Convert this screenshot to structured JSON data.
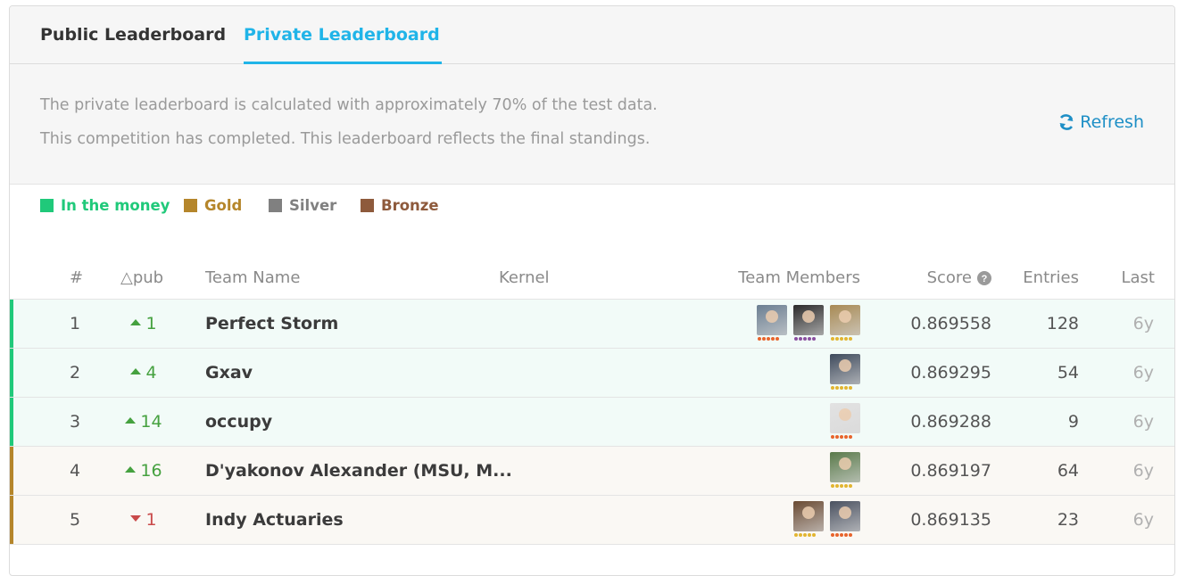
{
  "tabs": [
    {
      "label": "Public Leaderboard",
      "active": false
    },
    {
      "label": "Private Leaderboard",
      "active": true
    }
  ],
  "info": {
    "line1": "The private leaderboard is calculated with approximately 70% of the test data.",
    "line2": "This competition has completed. This leaderboard reflects the final standings.",
    "refresh_label": "Refresh",
    "refresh_icon": "refresh-icon"
  },
  "legend": [
    {
      "label": "In the money",
      "color": "#20c97a"
    },
    {
      "label": "Gold",
      "color": "#b5862b"
    },
    {
      "label": "Silver",
      "color": "#808080"
    },
    {
      "label": "Bronze",
      "color": "#8e5a3c"
    }
  ],
  "columns": {
    "rank": "#",
    "delta": "△pub",
    "team": "Team Name",
    "kernel": "Kernel",
    "members": "Team Members",
    "score": "Score",
    "entries": "Entries",
    "last": "Last"
  },
  "rows": [
    {
      "rank": "1",
      "delta": "1",
      "dir": "up",
      "team": "Perfect Storm",
      "score": "0.869558",
      "entries": "128",
      "last": "6y",
      "tier": "money",
      "members": [
        {
          "bg": "#6b7f92",
          "dots": "#e8642c"
        },
        {
          "bg": "#2a2a2a",
          "dots": "#8a4fa0"
        },
        {
          "bg": "#a88a54",
          "dots": "#e2b530"
        }
      ]
    },
    {
      "rank": "2",
      "delta": "4",
      "dir": "up",
      "team": "Gxav",
      "score": "0.869295",
      "entries": "54",
      "last": "6y",
      "tier": "money",
      "members": [
        {
          "bg": "#3e4a5c",
          "dots": "#e2b530"
        }
      ]
    },
    {
      "rank": "3",
      "delta": "14",
      "dir": "up",
      "team": "occupy",
      "score": "0.869288",
      "entries": "9",
      "last": "6y",
      "tier": "money",
      "members": [
        {
          "bg": "#e2e2e2",
          "dots": "#e8642c"
        }
      ]
    },
    {
      "rank": "4",
      "delta": "16",
      "dir": "up",
      "team": "D'yakonov Alexander (MSU, M...",
      "score": "0.869197",
      "entries": "64",
      "last": "6y",
      "tier": "gold",
      "members": [
        {
          "bg": "#5a7a4a",
          "dots": "#e2b530"
        }
      ]
    },
    {
      "rank": "5",
      "delta": "1",
      "dir": "down",
      "team": "Indy Actuaries",
      "score": "0.869135",
      "entries": "23",
      "last": "6y",
      "tier": "gold",
      "members": [
        {
          "bg": "#6a4a32",
          "dots": "#e2b530"
        },
        {
          "bg": "#4a5160",
          "dots": "#e8642c"
        }
      ]
    }
  ],
  "tier_colors": {
    "money": "#20c97a",
    "gold": "#b5862b"
  },
  "tier_backgrounds": {
    "money": "#f2fbf8",
    "gold": "#faf8f4"
  },
  "delta_colors": {
    "up": "#45a13f",
    "down": "#c94a4a"
  }
}
